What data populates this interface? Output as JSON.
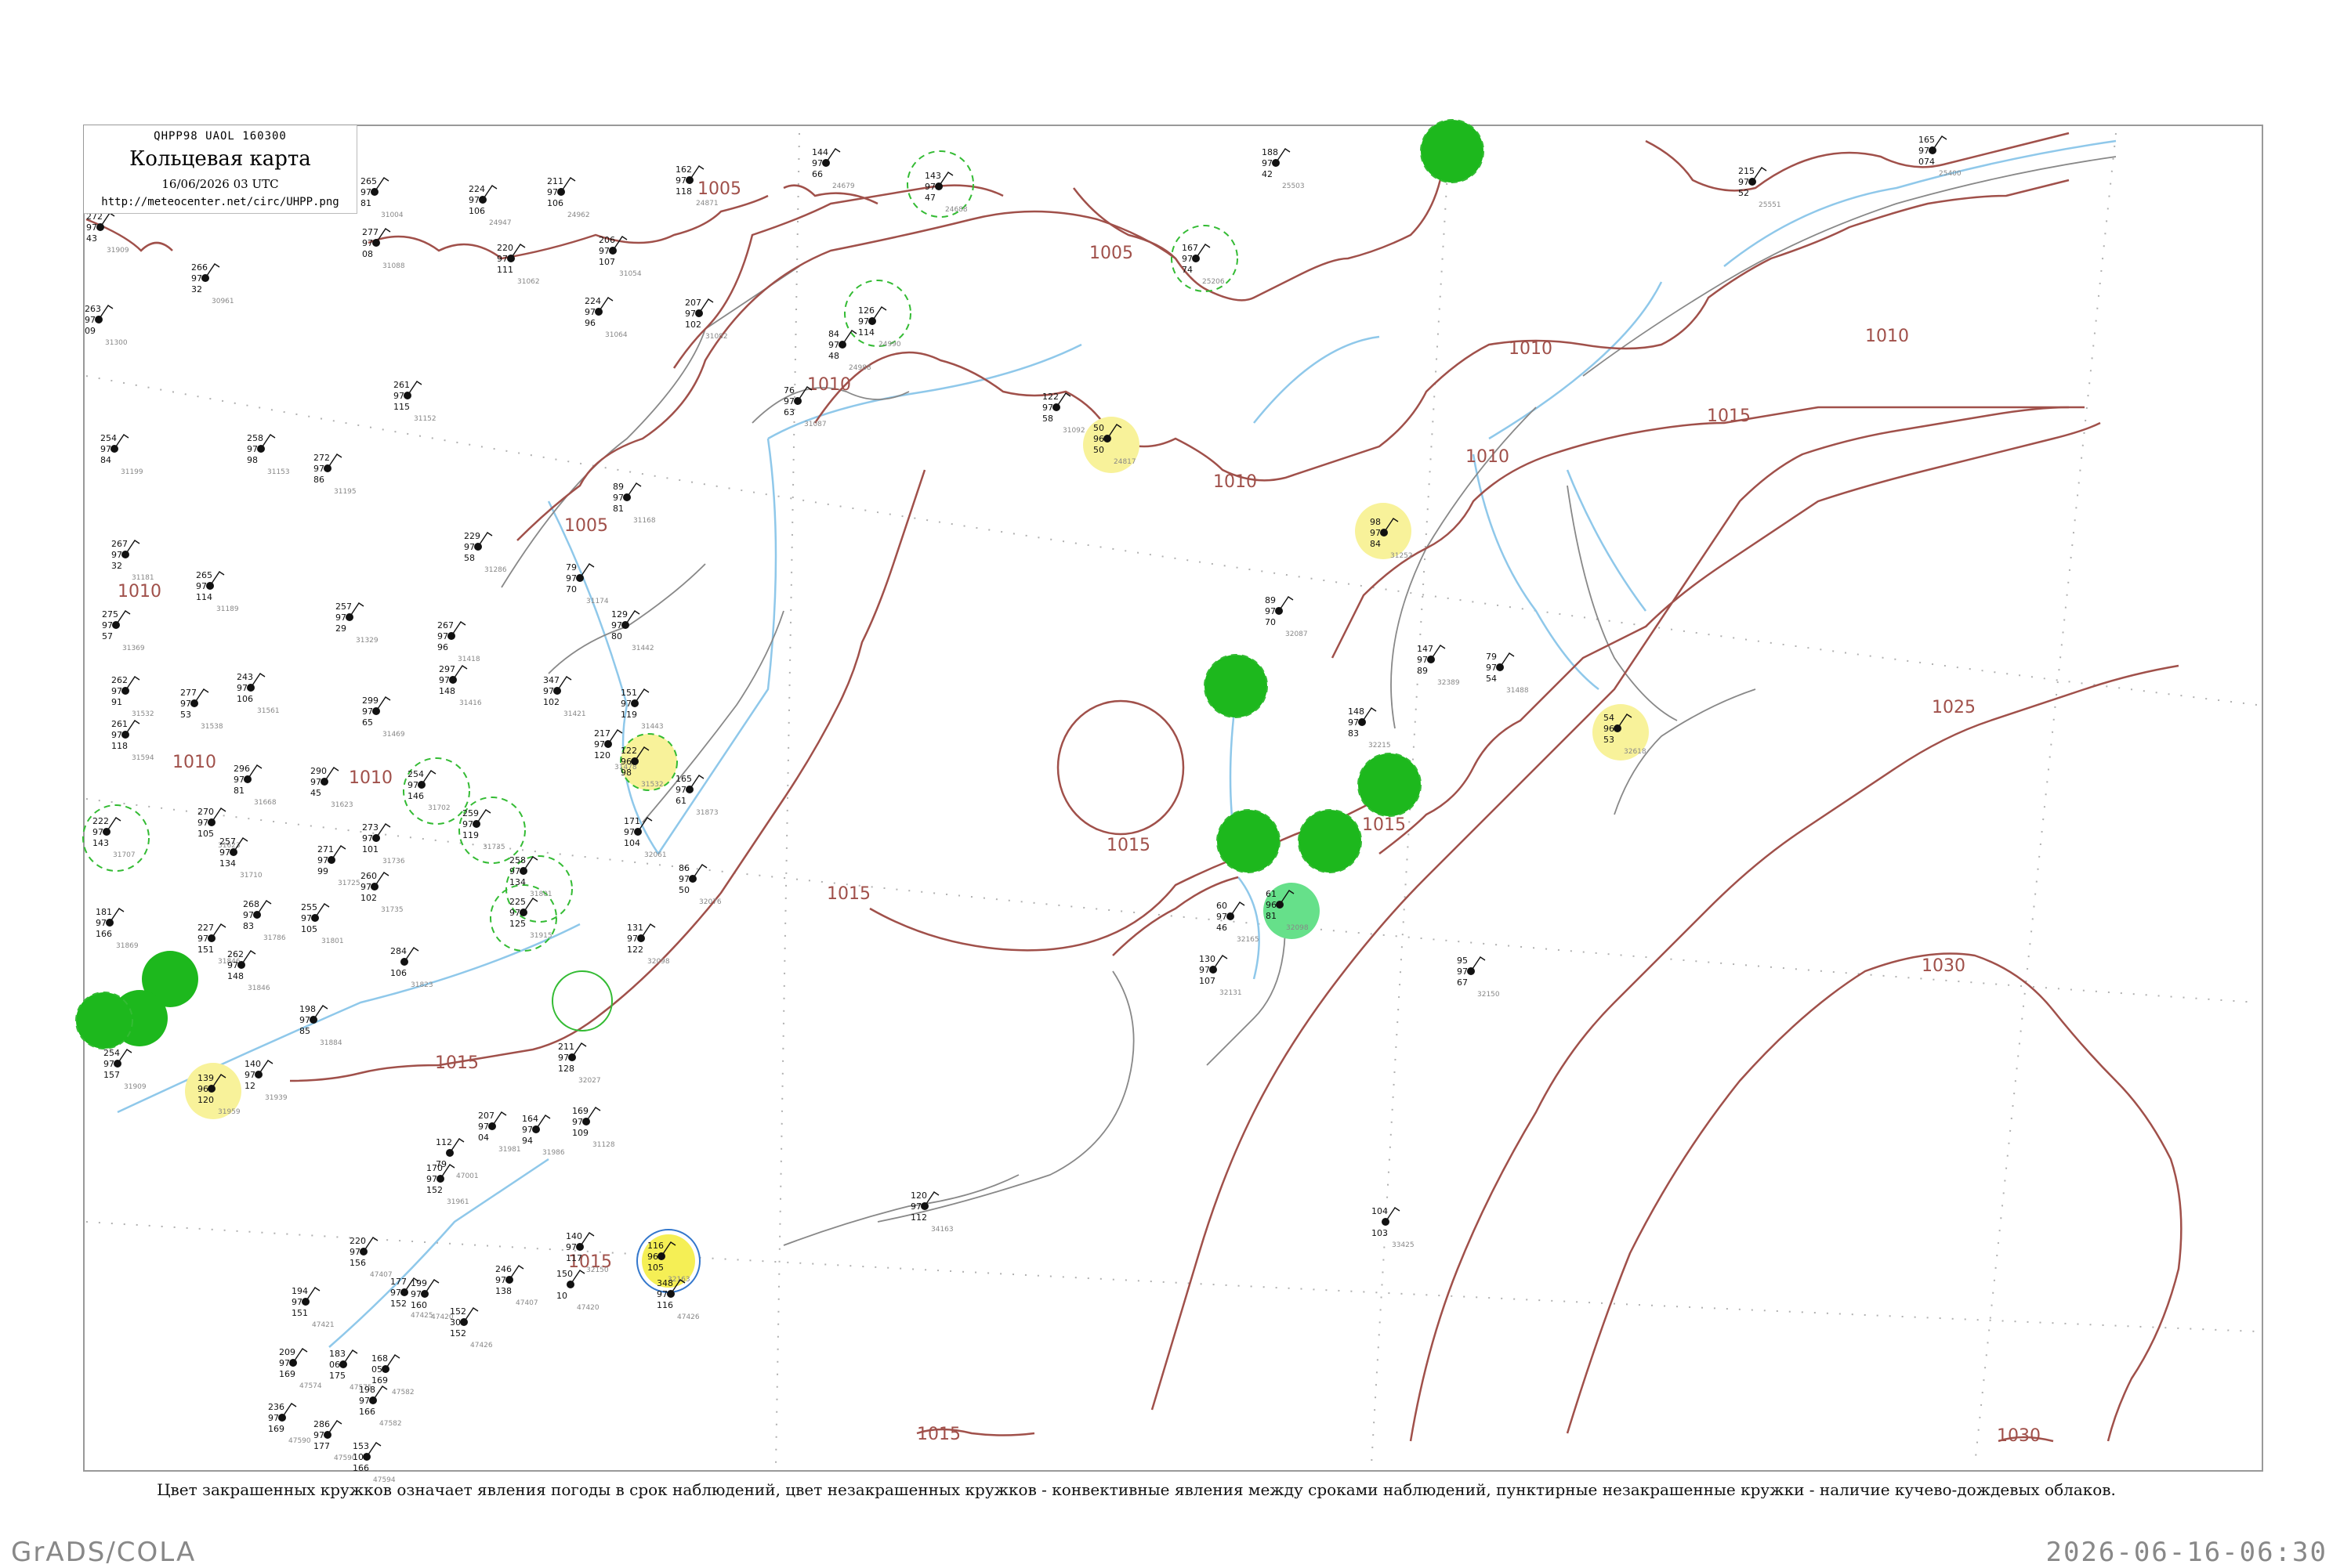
{
  "header": {
    "code": "QHPP98  UAOL  160300",
    "title": "Кольцевая карта",
    "date": "16/06/2026 03 UTC",
    "url": "http://meteocenter.net/circ/UHPP.png"
  },
  "caption": "Цвет закрашенных кружков означает явления погоды в срок наблюдений, цвет незакрашенных кружков - конвективные явления между сроками наблюдений, пунктирные незакрашенные кружки - наличие кучево-дождевых облаков.",
  "footer": {
    "left": "GrADS/COLA",
    "right": "2026-06-16-06:30"
  },
  "colors": {
    "isobar": "#a0504a",
    "river": "#8fc8ea",
    "green": "#1db81d",
    "light_green": "#66e08a",
    "yellow": "#f5ef55",
    "pale_yellow": "#f8f29a"
  },
  "isobar_labels": [
    "1005",
    "1005",
    "1005",
    "1010",
    "1010",
    "1010",
    "1010",
    "1010",
    "1010",
    "1010",
    "1010",
    "1015",
    "1015",
    "1015",
    "1015",
    "1015",
    "1015",
    "1015",
    "1025",
    "1030",
    "1030"
  ],
  "stations": [
    {
      "p": "272",
      "t": "97",
      "w": "43",
      "id": "31909"
    },
    {
      "p": "265",
      "t": "97",
      "w": "81",
      "id": "31004"
    },
    {
      "p": "224",
      "t": "97",
      "w": "106",
      "id": "24947"
    },
    {
      "p": "211",
      "t": "97",
      "w": "106",
      "id": "24962"
    },
    {
      "p": "162",
      "t": "97",
      "w": "118",
      "id": "24871"
    },
    {
      "p": "144",
      "t": "97",
      "w": "66",
      "id": "24679"
    },
    {
      "p": "143",
      "t": "97",
      "w": "47",
      "id": "24688"
    },
    {
      "p": "188",
      "t": "97",
      "w": "42",
      "id": "25503"
    },
    {
      "p": "215",
      "t": "97",
      "w": "52",
      "id": "25551"
    },
    {
      "p": "165",
      "t": "97",
      "w": "074",
      "id": "25400"
    },
    {
      "p": "263",
      "t": "97",
      "w": "09",
      "id": "31300"
    },
    {
      "p": "266",
      "t": "97",
      "w": "32",
      "id": "30961"
    },
    {
      "p": "277",
      "t": "97",
      "w": "08",
      "id": "31088"
    },
    {
      "p": "220",
      "t": "97",
      "w": "111",
      "id": "31062"
    },
    {
      "p": "206",
      "t": "97",
      "w": "107",
      "id": "31054"
    },
    {
      "p": "224",
      "t": "97",
      "w": "96",
      "id": "31064"
    },
    {
      "p": "207",
      "t": "97",
      "w": "102",
      "id": "31082"
    },
    {
      "p": "126",
      "t": "97",
      "w": "114",
      "id": "24990"
    },
    {
      "p": "84",
      "t": "97",
      "w": "48",
      "id": "24988"
    },
    {
      "p": "167",
      "t": "97",
      "w": "74",
      "id": "25206"
    },
    {
      "p": "76",
      "t": "97",
      "w": "63",
      "id": "31087"
    },
    {
      "p": "122",
      "t": "97",
      "w": "58",
      "id": "31092"
    },
    {
      "p": "50",
      "t": "96",
      "w": "50",
      "id": "24817"
    },
    {
      "p": "254",
      "t": "97",
      "w": "84",
      "id": "31199"
    },
    {
      "p": "258",
      "t": "97",
      "w": "98",
      "id": "31153"
    },
    {
      "p": "272",
      "t": "97",
      "w": "86",
      "id": "31195"
    },
    {
      "p": "261",
      "t": "97",
      "w": "115",
      "id": "31152"
    },
    {
      "p": "89",
      "t": "97",
      "w": "81",
      "id": "31168"
    },
    {
      "p": "98",
      "t": "97",
      "w": "84",
      "id": "31252"
    },
    {
      "p": "267",
      "t": "97",
      "w": "32",
      "id": "31181"
    },
    {
      "p": "265",
      "t": "97",
      "w": "114",
      "id": "31189"
    },
    {
      "p": "229",
      "t": "97",
      "w": "58",
      "id": "31286"
    },
    {
      "p": "79",
      "t": "97",
      "w": "70",
      "id": "31174"
    },
    {
      "p": "89",
      "t": "97",
      "w": "70",
      "id": "32087"
    },
    {
      "p": "275",
      "t": "97",
      "w": "57",
      "id": "31369"
    },
    {
      "p": "257",
      "t": "97",
      "w": "29",
      "id": "31329"
    },
    {
      "p": "267",
      "t": "97",
      "w": "96",
      "id": "31418"
    },
    {
      "p": "129",
      "t": "97",
      "w": "80",
      "id": "31442"
    },
    {
      "p": "347",
      "t": "97",
      "w": "102",
      "id": "31421"
    },
    {
      "p": "151",
      "t": "97",
      "w": "119",
      "id": "31443"
    },
    {
      "p": "147",
      "t": "97",
      "w": "89",
      "id": "32389"
    },
    {
      "p": "79",
      "t": "97",
      "w": "54",
      "id": "31488"
    },
    {
      "p": "262",
      "t": "97",
      "w": "91",
      "id": "31532"
    },
    {
      "p": "277",
      "t": "97",
      "w": "53",
      "id": "31538"
    },
    {
      "p": "243",
      "t": "97",
      "w": "106",
      "id": "31561"
    },
    {
      "p": "299",
      "t": "97",
      "w": "65",
      "id": "31469"
    },
    {
      "p": "297",
      "t": "97",
      "w": "148",
      "id": "31416"
    },
    {
      "p": "217",
      "t": "97",
      "w": "120",
      "id": "31478"
    },
    {
      "p": "148",
      "t": "97",
      "w": "83",
      "id": "32215"
    },
    {
      "p": "261",
      "t": "97",
      "w": "118",
      "id": "31594"
    },
    {
      "p": "254",
      "t": "97",
      "w": "146",
      "id": "31702"
    },
    {
      "p": "122",
      "t": "96",
      "w": "98",
      "id": "31532"
    },
    {
      "p": "165",
      "t": "97",
      "w": "61",
      "id": "31873"
    },
    {
      "p": "54",
      "t": "96",
      "w": "53",
      "id": "32618"
    },
    {
      "p": "296",
      "t": "97",
      "w": "81",
      "id": "31668"
    },
    {
      "p": "290",
      "t": "97",
      "w": "45",
      "id": "31623"
    },
    {
      "p": "259",
      "t": "97",
      "w": "119",
      "id": "31735"
    },
    {
      "p": "222",
      "t": "97",
      "w": "143",
      "id": "31707"
    },
    {
      "p": "270",
      "t": "97",
      "w": "105",
      "id": "31623"
    },
    {
      "p": "273",
      "t": "97",
      "w": "101",
      "id": "31736"
    },
    {
      "p": "171",
      "t": "97",
      "w": "104",
      "id": "32061"
    },
    {
      "p": "86",
      "t": "97",
      "w": "50",
      "id": "32076"
    },
    {
      "p": "271",
      "t": "97",
      "w": "99",
      "id": "31725"
    },
    {
      "p": "257",
      "t": "97",
      "w": "134",
      "id": "31710"
    },
    {
      "p": "260",
      "t": "97",
      "w": "102",
      "id": "31735"
    },
    {
      "p": "258",
      "t": "97",
      "w": "134",
      "id": "31801"
    },
    {
      "p": "268",
      "t": "97",
      "w": "83",
      "id": "31786"
    },
    {
      "p": "255",
      "t": "97",
      "w": "105",
      "id": "31801"
    },
    {
      "p": "225",
      "t": "97",
      "w": "125",
      "id": "31915"
    },
    {
      "p": "60",
      "t": "97",
      "w": "46",
      "id": "32165"
    },
    {
      "p": "181",
      "t": "97",
      "w": "166",
      "id": "31869"
    },
    {
      "p": "227",
      "t": "97",
      "w": "151",
      "id": "31846"
    },
    {
      "p": "131",
      "t": "97",
      "w": "122",
      "id": "32098"
    },
    {
      "p": "284",
      "t": "",
      "w": "106",
      "id": "31823"
    },
    {
      "p": "262",
      "t": "97",
      "w": "148",
      "id": "31846"
    },
    {
      "p": "61",
      "t": "96",
      "w": "81",
      "id": "32098"
    },
    {
      "p": "95",
      "t": "97",
      "w": "67",
      "id": "32150"
    },
    {
      "p": "130",
      "t": "97",
      "w": "107",
      "id": "32131"
    },
    {
      "p": "198",
      "t": "97",
      "w": "85",
      "id": "31884"
    },
    {
      "p": "254",
      "t": "97",
      "w": "157",
      "id": "31909"
    },
    {
      "p": "211",
      "t": "97",
      "w": "128",
      "id": "32027"
    },
    {
      "p": "139",
      "t": "96",
      "w": "120",
      "id": "31959"
    },
    {
      "p": "140",
      "t": "97",
      "w": "12",
      "id": "31939"
    },
    {
      "p": "169",
      "t": "97",
      "w": "109",
      "id": "31128"
    },
    {
      "p": "207",
      "t": "97",
      "w": "04",
      "id": "31981"
    },
    {
      "p": "164",
      "t": "97",
      "w": "94",
      "id": "31986"
    },
    {
      "p": "112",
      "t": "",
      "w": "79",
      "id": "47001"
    },
    {
      "p": "170",
      "t": "97",
      "w": "152",
      "id": "31961"
    },
    {
      "p": "120",
      "t": "97",
      "w": "112",
      "id": "34163"
    },
    {
      "p": "104",
      "t": "",
      "w": "103",
      "id": "33425"
    },
    {
      "p": "116",
      "t": "96",
      "w": "105",
      "id": "32163"
    },
    {
      "p": "140",
      "t": "97",
      "w": "117",
      "id": "32150"
    },
    {
      "p": "246",
      "t": "97",
      "w": "138",
      "id": "47407"
    },
    {
      "p": "150",
      "t": "",
      "w": "10",
      "id": "47420"
    },
    {
      "p": "348",
      "t": "97",
      "w": "116",
      "id": "47426"
    },
    {
      "p": "220",
      "t": "97",
      "w": "156",
      "id": "47407"
    },
    {
      "p": "177",
      "t": "97",
      "w": "152",
      "id": "47425"
    },
    {
      "p": "194",
      "t": "97",
      "w": "151",
      "id": "47421"
    },
    {
      "p": "199",
      "t": "97",
      "w": "160",
      "id": "47420"
    },
    {
      "p": "152",
      "t": "30",
      "w": "152",
      "id": "47426"
    },
    {
      "p": "209",
      "t": "97",
      "w": "169",
      "id": "47574"
    },
    {
      "p": "183",
      "t": "06",
      "w": "175",
      "id": "47575"
    },
    {
      "p": "168",
      "t": "05",
      "w": "169",
      "id": "47582"
    },
    {
      "p": "236",
      "t": "97",
      "w": "169",
      "id": "47590"
    },
    {
      "p": "198",
      "t": "97",
      "w": "166",
      "id": "47582"
    },
    {
      "p": "286",
      "t": "97",
      "w": "177",
      "id": "47590"
    },
    {
      "p": "153",
      "t": "10",
      "w": "166",
      "id": "47594"
    }
  ]
}
